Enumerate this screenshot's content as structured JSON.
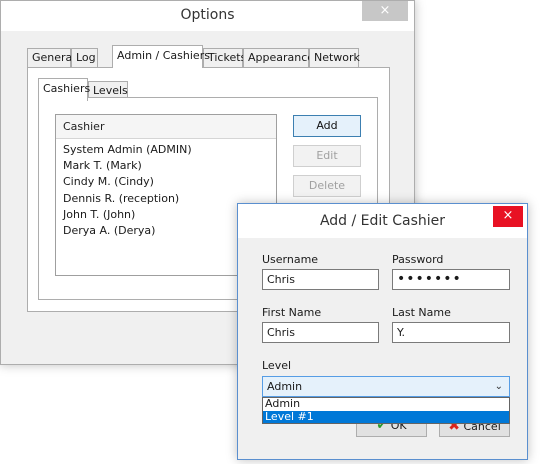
{
  "options_window": {
    "title": "Options",
    "close_label": "×",
    "tabs": [
      {
        "label": "General"
      },
      {
        "label": "Log"
      },
      {
        "label": "Admin / Cashiers",
        "active": true
      },
      {
        "label": "Tickets"
      },
      {
        "label": "Appearance"
      },
      {
        "label": "Network"
      }
    ],
    "subtabs": [
      {
        "label": "Cashiers",
        "active": true
      },
      {
        "label": "Levels"
      }
    ],
    "cashier_list": {
      "header": "Cashier",
      "items": [
        "System Admin (ADMIN)",
        "Mark T. (Mark)",
        "Cindy M. (Cindy)",
        "Dennis R. (reception)",
        "John T. (John)",
        "Derya A. (Derya)"
      ]
    },
    "buttons": {
      "add": "Add",
      "edit": "Edit",
      "delete": "Delete"
    }
  },
  "cashier_dialog": {
    "title": "Add / Edit Cashier",
    "close_label": "×",
    "username_label": "Username",
    "username_value": "Chris",
    "password_label": "Password",
    "password_value": "•••••••",
    "first_name_label": "First Name",
    "first_name_value": "Chris",
    "last_name_label": "Last Name",
    "last_name_value": "Y.",
    "level_label": "Level",
    "level_value": "Admin",
    "level_options": [
      "Admin",
      "Level #1"
    ],
    "highlighted_option": "Level #1",
    "ok_label": "OK",
    "cancel_label": "Cancel"
  }
}
